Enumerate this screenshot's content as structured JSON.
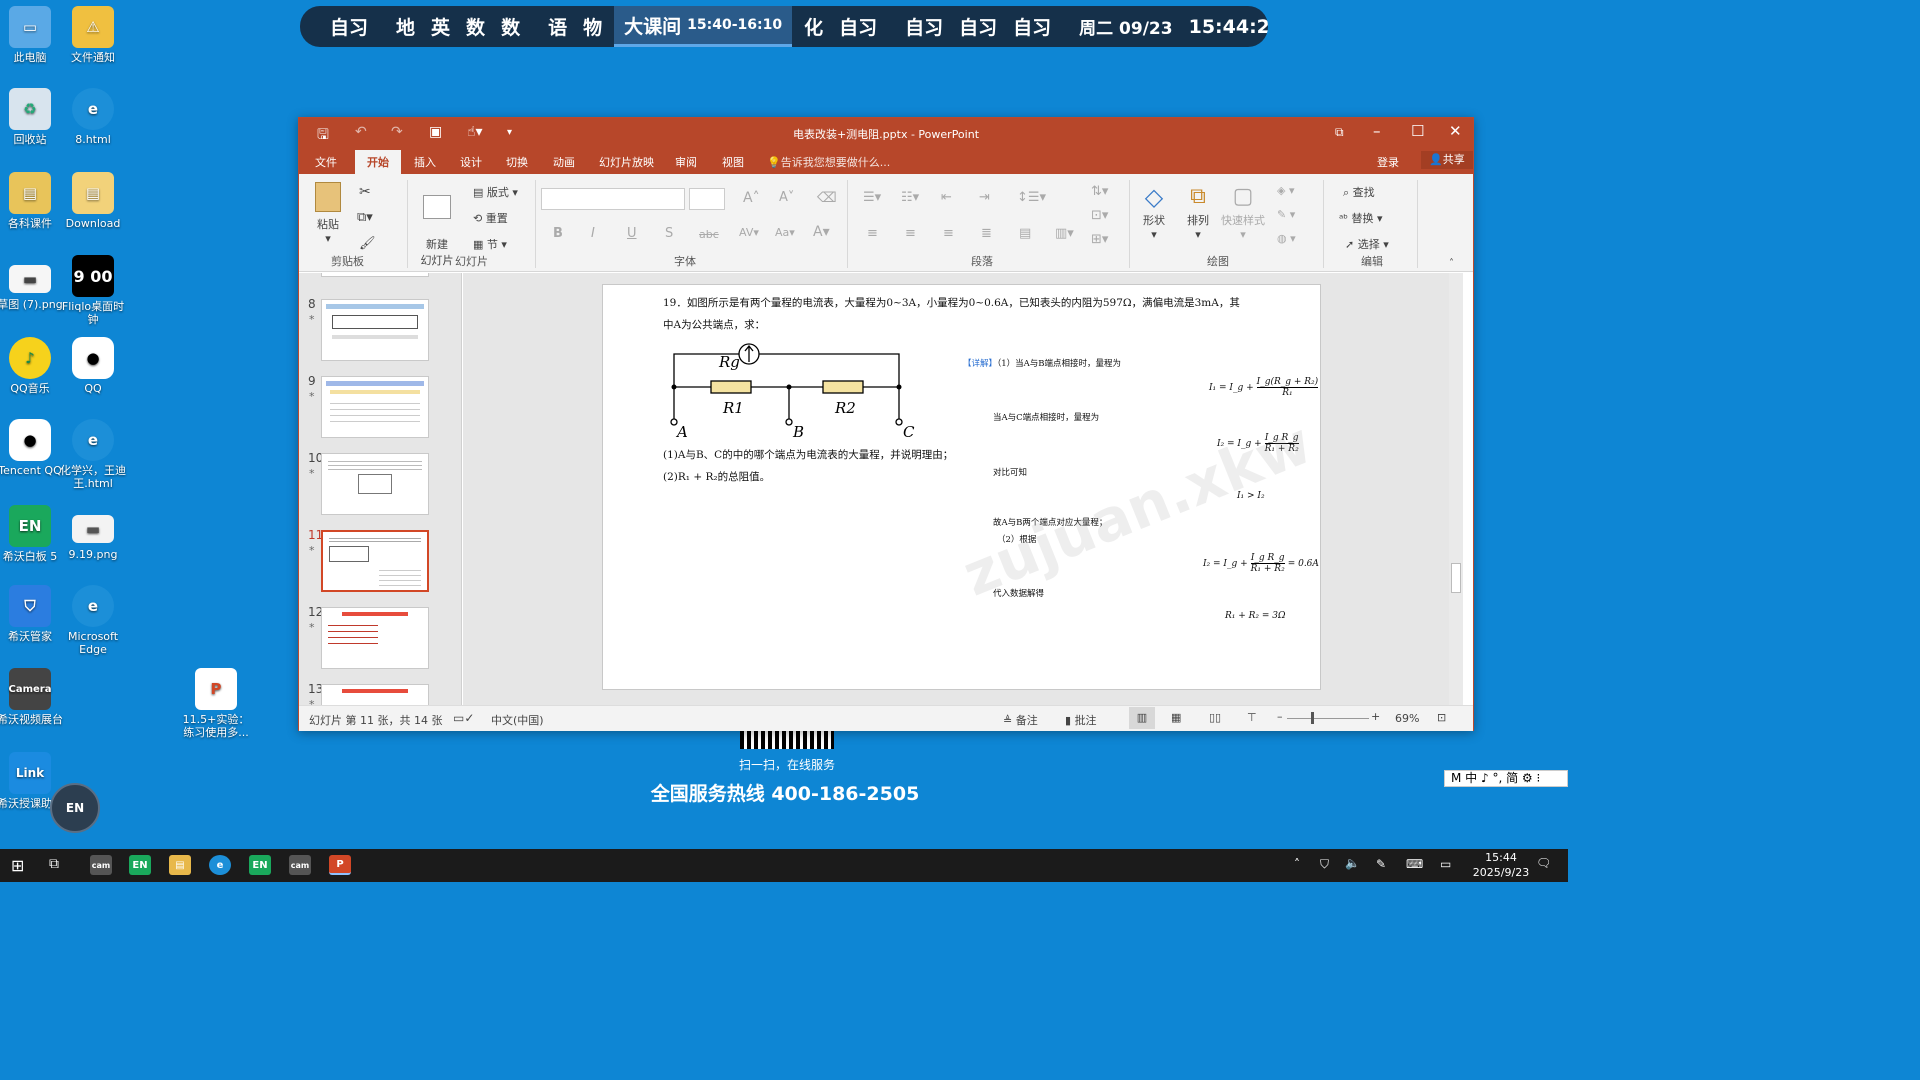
{
  "desktop": {
    "icons": [
      {
        "label": "此电脑"
      },
      {
        "label": "文件通知"
      },
      {
        "label": "回收站"
      },
      {
        "label": "8.html"
      },
      {
        "label": "各科课件"
      },
      {
        "label": "Download"
      },
      {
        "label": "草图 (7).png"
      },
      {
        "label": "Fliqlo桌面时钟"
      },
      {
        "label": "QQ音乐"
      },
      {
        "label": "QQ"
      },
      {
        "label": "Tencent QQ"
      },
      {
        "label": "化学兴，王迪王.html"
      },
      {
        "label": "希沃白板 5"
      },
      {
        "label": "9.19.png"
      },
      {
        "label": "希沃管家"
      },
      {
        "label": "Microsoft Edge"
      },
      {
        "label": "希沃视频展台"
      },
      {
        "label": "11.5+实验：练习使用多..."
      },
      {
        "label": "希沃授课助手"
      }
    ],
    "fliqlo_time": "9 00",
    "promo": {
      "scan_text": "扫一扫，在线服务",
      "hotline": "全国服务热线 400-186-2505"
    },
    "ime_bar": "M 中 ♪ °, 简 ⚙ ⁝"
  },
  "schedule_bar": {
    "groups": [
      [
        "自习"
      ],
      [
        "地",
        "英",
        "数",
        "数"
      ],
      [
        "语",
        "物"
      ],
      [
        "化",
        "自习"
      ],
      [
        "自习",
        "自习",
        "自习"
      ]
    ],
    "current": {
      "label": "大课间",
      "time": "15:40-16:10"
    },
    "date": "周二 09/23",
    "clock": "15:44:23"
  },
  "ppt": {
    "title": "电表改装+测电阻.pptx - PowerPoint",
    "tabs": [
      "文件",
      "开始",
      "插入",
      "设计",
      "切换",
      "动画",
      "幻灯片放映",
      "审阅",
      "视图"
    ],
    "active_tab": "开始",
    "tell_me": "告诉我您想要做什么...",
    "login": "登录",
    "share": "共享",
    "ribbon": {
      "paste": "粘贴",
      "clipboard": "剪贴板",
      "new_slide": "新建\n幻灯片",
      "layout": "版式",
      "reset": "重置",
      "section": "节",
      "slides": "幻灯片",
      "font": "字体",
      "paragraph": "段落",
      "shape": "形状",
      "arrange": "排列",
      "quick_styles": "快速样式",
      "drawing": "绘图",
      "find": "查找",
      "replace": "替换",
      "select": "选择",
      "editing": "编辑"
    },
    "thumbnails": [
      {
        "num": "8",
        "star": "*"
      },
      {
        "num": "9",
        "star": "*"
      },
      {
        "num": "10",
        "star": "*"
      },
      {
        "num": "11",
        "star": "*"
      },
      {
        "num": "12",
        "star": "*"
      },
      {
        "num": "13",
        "star": "*"
      }
    ],
    "slide": {
      "q_line1": "19．如图所示是有两个量程的电流表，大量程为0~3A，小量程为0~0.6A，已知表头的内阻为597Ω，满偏电流是3mA，其",
      "q_line2": "中A为公共端点，求：",
      "sub1": "(1)A与B、C的中的哪个端点为电流表的大量程，并说明理由；",
      "sub2": "(2)R₁ + R₂的总阻值。",
      "circuit": {
        "rg": "Rg",
        "r1": "R1",
        "r2": "R2",
        "a": "A",
        "b": "B",
        "c": "C"
      },
      "detail_tag": "【详解】",
      "detail_1": "（1）当A与B端点相接时，量程为",
      "detail_2": "当A与C端点相接时，量程为",
      "detail_3": "对比可知",
      "detail_4": "故A与B两个端点对应大量程；",
      "detail_5": "（2）根据",
      "detail_6": "代入数据解得",
      "eq1_lhs": "I₁ = I_g +",
      "eq1_num": "I_g(R_g + R₂)",
      "eq1_den": "R₁",
      "eq2_lhs": "I₂ = I_g +",
      "eq2_num": "I_g R_g",
      "eq2_den": "R₁ + R₂",
      "eq3": "I₁ > I₂",
      "eq4_lhs": "I₂ = I_g +",
      "eq4_num": "I_g R_g",
      "eq4_den": "R₁ + R₂",
      "eq4_rhs": "= 0.6A",
      "eq5": "R₁ + R₂ = 3Ω",
      "watermark": "zujuan.xkw"
    },
    "status": {
      "slide_of": "幻灯片 第 11 张，共 14 张",
      "language": "中文(中国)",
      "notes": "备注",
      "comments": "批注",
      "zoom": "69%"
    }
  },
  "taskbar": {
    "time": "15:44",
    "date": "2025/9/23"
  }
}
